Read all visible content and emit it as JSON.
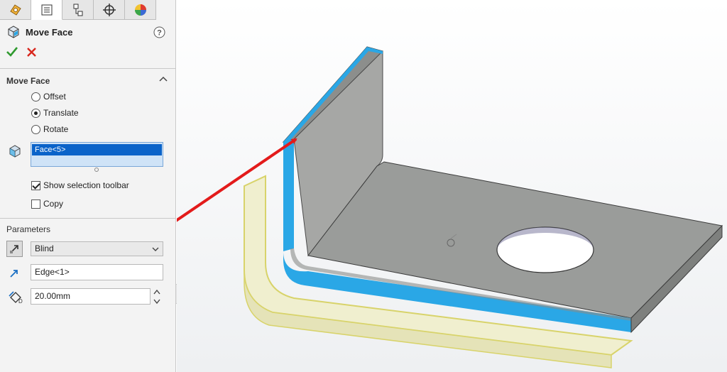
{
  "property_manager": {
    "title": "Move Face",
    "section_title": "Move Face",
    "options": [
      {
        "label": "Offset",
        "selected": false
      },
      {
        "label": "Translate",
        "selected": true
      },
      {
        "label": "Rotate",
        "selected": false
      }
    ],
    "selection": [
      "Face<5>"
    ],
    "show_selection_toolbar": {
      "label": "Show selection toolbar",
      "checked": true
    },
    "copy": {
      "label": "Copy",
      "checked": false
    },
    "parameters": {
      "title": "Parameters",
      "end_condition": "Blind",
      "direction_reference": "Edge<1>",
      "distance": "20.00mm"
    }
  },
  "colors": {
    "selection_blue": "#0a63c9",
    "face_highlight": "#2aa7e6",
    "preview_yellow": "#f0efcf",
    "arrow_red": "#e31b1b",
    "part_gray": "#9a9c9a"
  },
  "icons": {
    "tabs": [
      "feature-manager-icon",
      "property-manager-icon",
      "configuration-manager-icon",
      "dimxpert-icon",
      "display-manager-icon"
    ],
    "header": "move-face-icon",
    "help": "help-icon",
    "ok": "ok-check-icon",
    "cancel": "cancel-x-icon"
  }
}
